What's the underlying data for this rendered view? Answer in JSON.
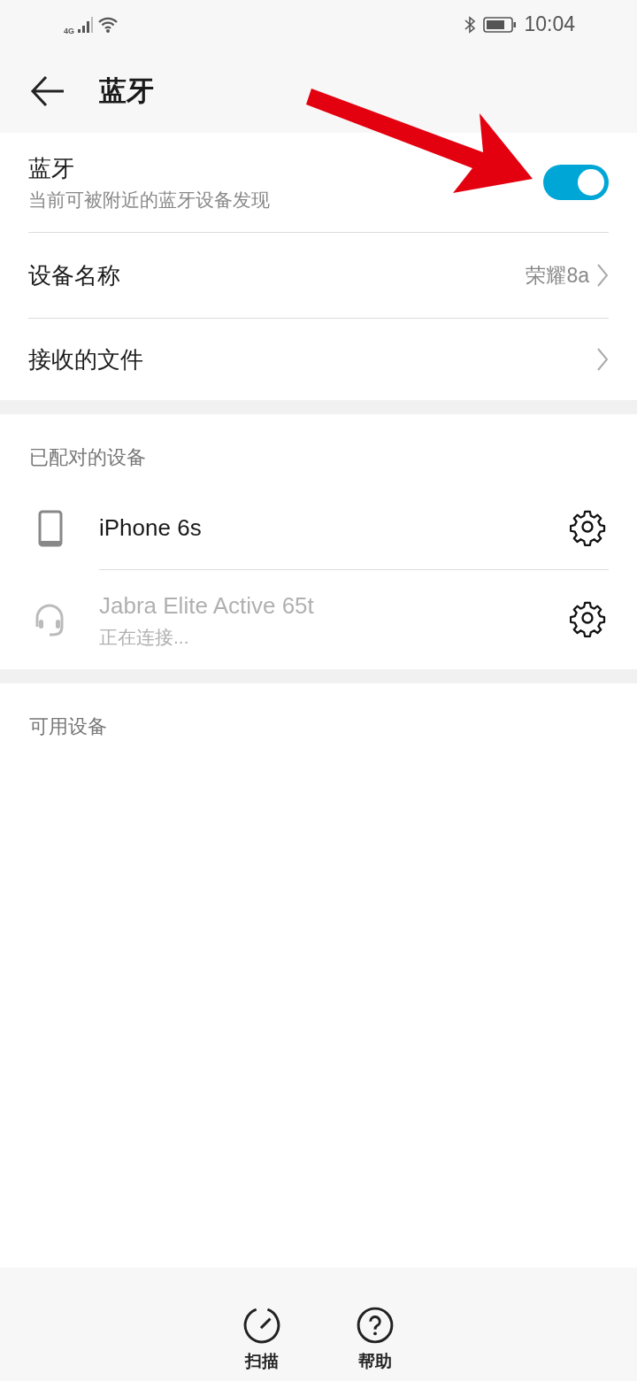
{
  "status_bar": {
    "network": "4G",
    "time": "10:04"
  },
  "header": {
    "title": "蓝牙"
  },
  "settings": [
    {
      "kind": "toggle",
      "title": "蓝牙",
      "subtitle": "当前可被附近的蓝牙设备发现",
      "on": true
    },
    {
      "kind": "link",
      "title": "设备名称",
      "value": "荣耀8a"
    },
    {
      "kind": "link",
      "title": "接收的文件"
    }
  ],
  "paired": {
    "heading": "已配对的设备",
    "devices": [
      {
        "kind": "phone",
        "name": "iPhone 6s",
        "disabled": false
      },
      {
        "kind": "headset",
        "name": "Jabra Elite Active 65t",
        "status": "正在连接...",
        "disabled": true
      }
    ]
  },
  "available": {
    "heading": "可用设备"
  },
  "bottom_bar": [
    {
      "kind": "scan",
      "label": "扫描"
    },
    {
      "kind": "help",
      "label": "帮助"
    }
  ]
}
